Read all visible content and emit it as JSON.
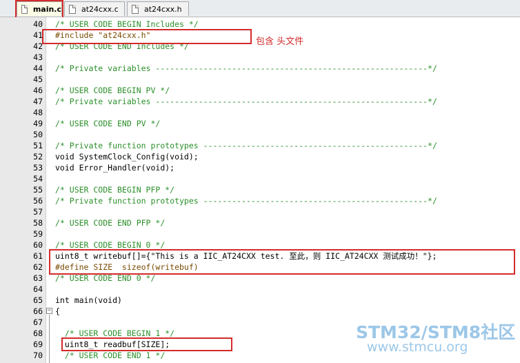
{
  "tabs": [
    {
      "label": "main.c",
      "active": true
    },
    {
      "label": "at24cxx.c",
      "active": false
    },
    {
      "label": "at24cxx.h",
      "active": false
    }
  ],
  "lines": [
    {
      "n": "40",
      "text": "/* USER CODE BEGIN Includes */",
      "kind": "cm"
    },
    {
      "n": "41",
      "text": "#include \"at24cxx.h\"",
      "kind": "inc"
    },
    {
      "n": "42",
      "text": "/* USER CODE END Includes */",
      "kind": "cm"
    },
    {
      "n": "43",
      "text": "",
      "kind": "cm"
    },
    {
      "n": "44",
      "text": "/* Private variables ---------------------------------------------------------*/",
      "kind": "cm"
    },
    {
      "n": "45",
      "text": "",
      "kind": "cm"
    },
    {
      "n": "46",
      "text": "/* USER CODE BEGIN PV */",
      "kind": "cm"
    },
    {
      "n": "47",
      "text": "/* Private variables ---------------------------------------------------------*/",
      "kind": "cm"
    },
    {
      "n": "48",
      "text": "",
      "kind": "cm"
    },
    {
      "n": "49",
      "text": "/* USER CODE END PV */",
      "kind": "cm"
    },
    {
      "n": "50",
      "text": "",
      "kind": "cm"
    },
    {
      "n": "51",
      "text": "/* Private function prototypes -----------------------------------------------*/",
      "kind": "cm"
    },
    {
      "n": "52",
      "text": "void SystemClock_Config(void);",
      "kind": "kw"
    },
    {
      "n": "53",
      "text": "void Error_Handler(void);",
      "kind": "kw"
    },
    {
      "n": "54",
      "text": "",
      "kind": "cm"
    },
    {
      "n": "55",
      "text": "/* USER CODE BEGIN PFP */",
      "kind": "cm"
    },
    {
      "n": "56",
      "text": "/* Private function prototypes -----------------------------------------------*/",
      "kind": "cm"
    },
    {
      "n": "57",
      "text": "",
      "kind": "cm"
    },
    {
      "n": "58",
      "text": "/* USER CODE END PFP */",
      "kind": "cm"
    },
    {
      "n": "59",
      "text": "",
      "kind": "cm"
    },
    {
      "n": "60",
      "text": "/* USER CODE BEGIN 0 */",
      "kind": "cm"
    },
    {
      "n": "61",
      "text": "uint8_t writebuf[]={\"This is a IIC_AT24CXX test. 至此，则 IIC_AT24CXX 测试成功！\"};",
      "kind": "str"
    },
    {
      "n": "62",
      "text": "#define SIZE  sizeof(writebuf)",
      "kind": "def"
    },
    {
      "n": "63",
      "text": "/* USER CODE END 0 */",
      "kind": "cm"
    },
    {
      "n": "64",
      "text": "",
      "kind": "cm"
    },
    {
      "n": "65",
      "text": "int main(void)",
      "kind": "kw"
    },
    {
      "n": "66",
      "text": "{",
      "kind": "kw"
    },
    {
      "n": "67",
      "text": "",
      "kind": "cm"
    },
    {
      "n": "68",
      "text": "  /* USER CODE BEGIN 1 */",
      "kind": "cm"
    },
    {
      "n": "69",
      "text": "  uint8_t readbuf[SIZE];",
      "kind": "kw"
    },
    {
      "n": "70",
      "text": "  /* USER CODE END 1 */",
      "kind": "cm"
    }
  ],
  "annotation": "包含 头文件",
  "watermark": {
    "line1": "STM32/STM8社区",
    "line2": "www.stmcu.org"
  }
}
